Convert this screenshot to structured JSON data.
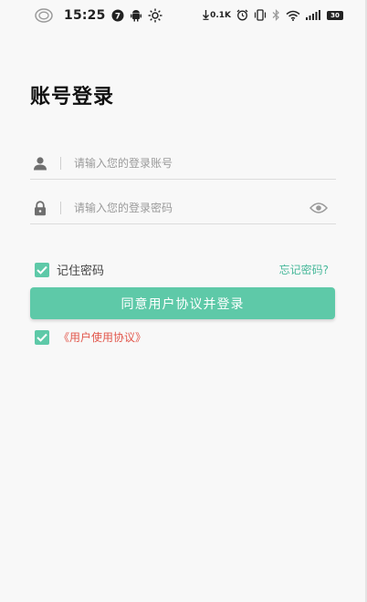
{
  "status_bar": {
    "time": "15:25",
    "notification_badge": "7",
    "net_speed": "0.1K",
    "battery_level": "30",
    "icons": [
      "circle-icon",
      "notification-badge-icon",
      "android-icon",
      "sun-icon",
      "download-arrow-icon",
      "alarm-icon",
      "vibrate-icon",
      "bluetooth-icon",
      "wifi-icon",
      "signal-icon",
      "battery-icon"
    ]
  },
  "login": {
    "title": "账号登录",
    "account": {
      "placeholder": "请输入您的登录账号",
      "value": "",
      "icon": "user-icon"
    },
    "password": {
      "placeholder": "请输入您的登录密码",
      "value": "",
      "icon": "lock-icon",
      "toggle_icon": "eye-icon"
    },
    "remember_label": "记住密码",
    "remember_checked": true,
    "forgot_label": "忘记密码?",
    "login_button_label": "同意用户协议并登录",
    "agreement_checked": true,
    "agreement_link": "《用户使用协议》"
  },
  "colors": {
    "accent": "#5ec9a8",
    "link_green": "#47b89a",
    "link_red": "#e2574c",
    "background": "#f8f8f8"
  }
}
